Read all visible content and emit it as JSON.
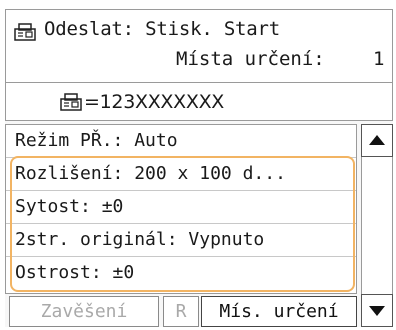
{
  "header": {
    "icon": "fax-icon",
    "title": "Odeslat: Stisk. Start",
    "destinations_label": "Místa určení:",
    "destinations_count": "1"
  },
  "number": {
    "icon": "fax-icon",
    "value": "=123XXXXXXX"
  },
  "list": {
    "items": [
      {
        "label": "Režim PŘ.: Auto"
      },
      {
        "label": "Rozlišení: 200 x 100 d..."
      },
      {
        "label": "Sytost: ±0"
      },
      {
        "label": "2str. originál: Vypnuto"
      },
      {
        "label": "Ostrost: ±0"
      }
    ],
    "highlight_color": "#f2b463"
  },
  "scroll": {
    "up_icon": "triangle-up-icon",
    "down_icon": "triangle-down-icon"
  },
  "bottom": {
    "hang_label": "Zavěšení",
    "r_label": "R",
    "destinations_label": "Mís. určení"
  }
}
